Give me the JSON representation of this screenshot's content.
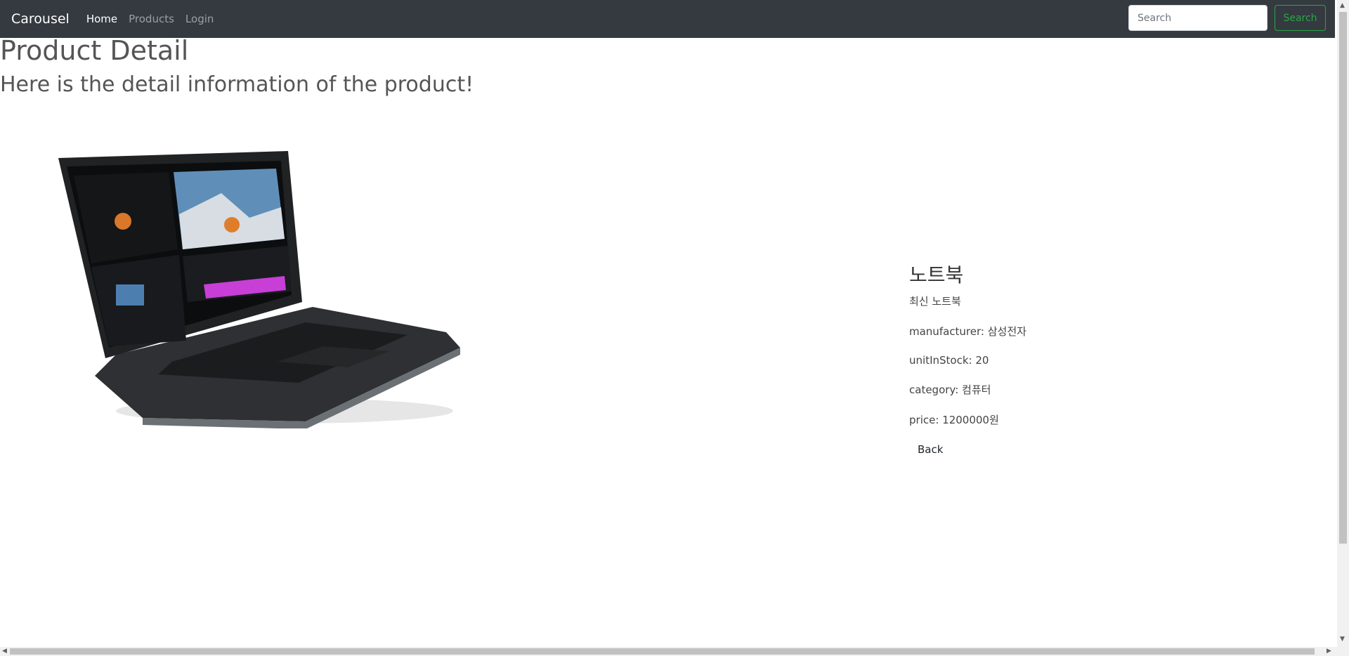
{
  "navbar": {
    "brand": "Carousel",
    "links": [
      {
        "label": "Home",
        "active": true
      },
      {
        "label": "Products",
        "active": false
      },
      {
        "label": "Login",
        "active": false
      }
    ],
    "search_placeholder": "Search",
    "search_button": "Search"
  },
  "page": {
    "title": "Product Detail",
    "subtitle": "Here is the detail information of the product!"
  },
  "product": {
    "name": "노트북",
    "description": "최신 노트북",
    "manufacturer": "manufacturer: 삼성전자",
    "unit_in_stock": "unitInStock: 20",
    "category": "category: 컴퓨터",
    "price": "price: 1200000원",
    "back_label": "Back"
  },
  "colors": {
    "navbar_bg": "#343a40",
    "search_button": "#28a745",
    "heading": "#555555"
  }
}
